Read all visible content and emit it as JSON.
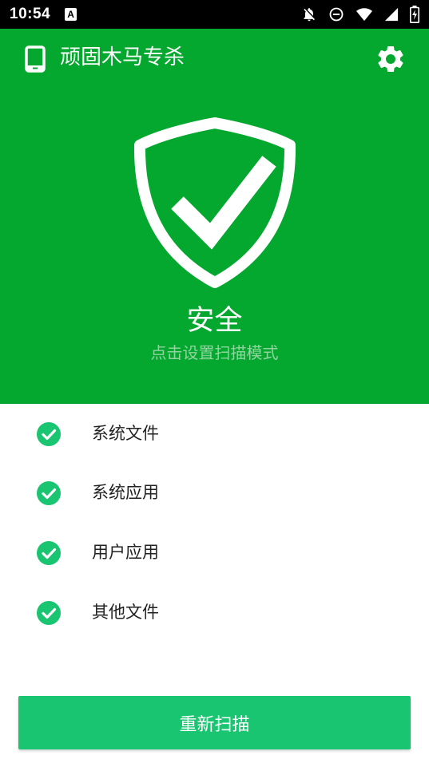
{
  "statusbar": {
    "time": "10:54",
    "badge": "A"
  },
  "app": {
    "title": "顽固木马专杀",
    "accent_color": "#05a82f",
    "button_color": "#19c571"
  },
  "status": {
    "title": "安全",
    "subtitle": "点击设置扫描模式"
  },
  "scan_items": [
    {
      "label": "系统文件",
      "icon": "check-circle-icon"
    },
    {
      "label": "系统应用",
      "icon": "check-circle-icon"
    },
    {
      "label": "用户应用",
      "icon": "check-circle-icon"
    },
    {
      "label": "其他文件",
      "icon": "check-circle-icon"
    }
  ],
  "actions": {
    "rescan_label": "重新扫描"
  }
}
